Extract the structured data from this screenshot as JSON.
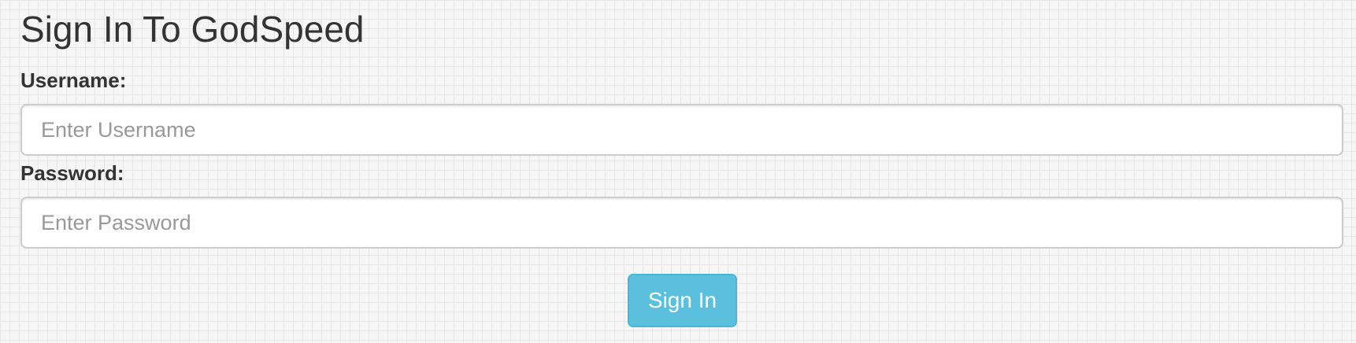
{
  "page": {
    "title": "Sign In To GodSpeed"
  },
  "form": {
    "username": {
      "label": "Username:",
      "placeholder": "Enter Username",
      "value": ""
    },
    "password": {
      "label": "Password:",
      "placeholder": "Enter Password",
      "value": ""
    },
    "submit_label": "Sign In"
  },
  "colors": {
    "button_bg": "#5bc0de",
    "button_border": "#46b8da",
    "text": "#333333",
    "placeholder": "#999999",
    "background": "#f6f6f6"
  }
}
